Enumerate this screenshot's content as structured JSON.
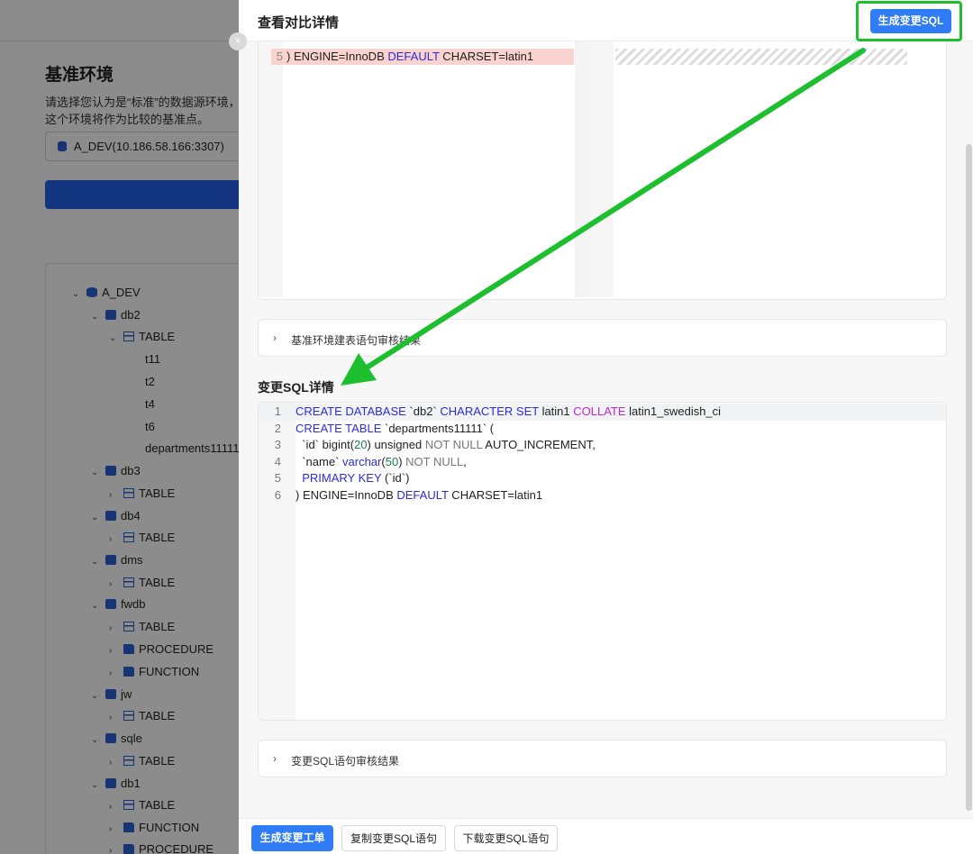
{
  "background": {
    "heading": "基准环境",
    "description_lines": [
      "请选择您认为是“标准”的数据源环境，",
      "这个环境将作为比较的基准点。"
    ],
    "selected_datasource": "A_DEV(10.186.58.166:3307)",
    "tree": {
      "root": "A_DEV",
      "db2": "db2",
      "db2_table": "TABLE",
      "db2_tables": [
        "t11",
        "t2",
        "t4",
        "t6",
        "departments11111"
      ],
      "db3": "db3",
      "db3_table": "TABLE",
      "db4": "db4",
      "db4_table": "TABLE",
      "dms": "dms",
      "dms_table": "TABLE",
      "fwdb": "fwdb",
      "fwdb_table": "TABLE",
      "fwdb_procedure": "PROCEDURE",
      "fwdb_function": "FUNCTION",
      "jw": "jw",
      "jw_table": "TABLE",
      "sqle": "sqle",
      "sqle_table": "TABLE",
      "db1": "db1",
      "db1_table": "TABLE",
      "db1_function": "FUNCTION",
      "db1_procedure": "PROCEDURE"
    }
  },
  "drawer": {
    "title": "查看对比详情",
    "close_icon": "×",
    "generate_sql_label": "生成变更SQL",
    "diff": {
      "left_line_number": "5",
      "left_line_text_a": ") ENGINE=InnoDB ",
      "left_line_kw": "DEFAULT",
      "left_line_text_b": " CHARSET=latin1"
    },
    "base_audit_label": "基准环境建表语句审核结果",
    "change_sql_title": "变更SQL详情",
    "sql_lines": {
      "l1": {
        "n": "1",
        "a": "CREATE DATABASE",
        "b": " `db2` ",
        "c": "CHARACTER SET",
        "d": " latin1 ",
        "e": "COLLATE",
        "f": " latin1_swedish_ci"
      },
      "l2": {
        "n": "2",
        "a": "CREATE TABLE",
        "b": " `departments11111` ("
      },
      "l3": {
        "n": "3",
        "a": "  `id` bigint(",
        "num": "20",
        "b": ") unsigned ",
        "c": "NOT NULL",
        "d": " AUTO_INCREMENT,"
      },
      "l4": {
        "n": "4",
        "a": "  `name` ",
        "b": "varchar",
        "c": "(",
        "num": "50",
        "d": ") ",
        "e": "NOT NULL",
        "f": ","
      },
      "l5": {
        "n": "5",
        "a": "  PRIMARY KEY",
        "b": " (`id`)"
      },
      "l6": {
        "n": "6",
        "a": ") ENGINE=InnoDB ",
        "b": "DEFAULT",
        "c": " CHARSET=latin1"
      }
    },
    "change_audit_label": "变更SQL语句审核结果",
    "footer": {
      "create_ticket": "生成变更工单",
      "copy_sql": "复制变更SQL语句",
      "download_sql": "下载变更SQL语句"
    }
  },
  "colors": {
    "primary": "#2f7cf6",
    "highlight_green": "#1dbf2f",
    "diff_removed": "#fbd3ce",
    "keyword": "#2c2cd8",
    "keyword_alt": "#c026d3",
    "number": "#1a7f4b"
  }
}
